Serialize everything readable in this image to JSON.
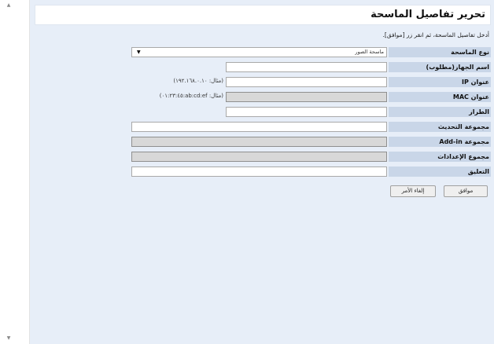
{
  "page": {
    "title": "تحرير تفاصيل الماسحة",
    "instruction": "أدخل تفاصيل الماسحة، ثم انقر زر [موافق]."
  },
  "form": {
    "scanner_type": {
      "label": "نوع الماسحة",
      "value": "ماسحة الصور"
    },
    "device_name": {
      "label": "اسم الجهاز(مطلوب)",
      "value": ""
    },
    "ip_address": {
      "label": "عنوان IP",
      "value": "",
      "hint": "(مثال: ١٩٢.١٦٨.٠.١٠)"
    },
    "mac_address": {
      "label": "عنوان MAC",
      "value": "",
      "hint": "(مثال: ab:cd:ef:٠١:٢٣:٤٥)"
    },
    "model": {
      "label": "الطراز",
      "value": ""
    },
    "update_group": {
      "label": "مجموعة التحديث",
      "value": ""
    },
    "addin_group": {
      "label": "مجموعة Add-in",
      "value": ""
    },
    "settings_group": {
      "label": "مجموع الإعدادات",
      "value": ""
    },
    "comment": {
      "label": "التعليق",
      "value": ""
    }
  },
  "buttons": {
    "ok": "موافق",
    "cancel": "إلغاء الأمر"
  },
  "icons": {
    "dropdown": "chevron-down-icon",
    "scroll_up": "scroll-up-arrow-icon",
    "scroll_down": "scroll-down-arrow-icon"
  }
}
